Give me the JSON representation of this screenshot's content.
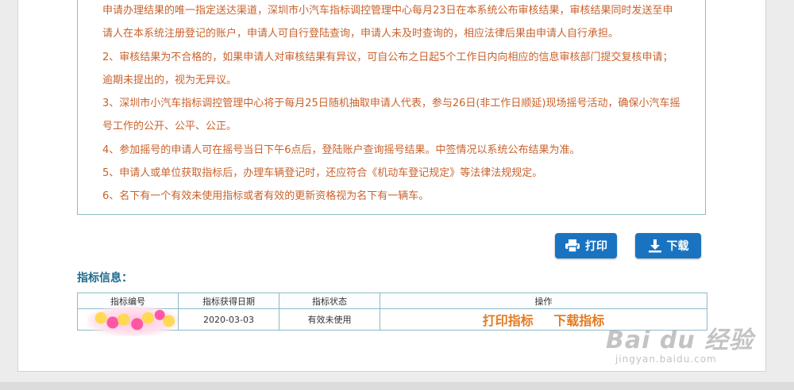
{
  "notice": {
    "lines": [
      "申请办理结果的唯一指定送达渠道，深圳市小汽车指标调控管理中心每月23日在本系统公布审核结果，审核结果同时发送至申",
      "请人在本系统注册登记的账户，申请人可自行登陆查询，申请人未及时查询的，相应法律后果由申请人自行承担。",
      "2、审核结果为不合格的，如果申请人对审核结果有异议，可自公布之日起5个工作日内向相应的信息审核部门提交复核申请；",
      "逾期未提出的，视为无异议。",
      "3、深圳市小汽车指标调控管理中心将于每月25日随机抽取申请人代表，参与26日(非工作日顺延)现场摇号活动，确保小汽车摇",
      "号工作的公开、公平、公正。",
      "4、参加摇号的申请人可在摇号当日下午6点后，登陆账户查询摇号结果。中签情况以系统公布结果为准。",
      "5、申请人或单位获取指标后，办理车辆登记时，还应符合《机动车登记规定》等法律法规规定。",
      "6、名下有一个有效未使用指标或者有效的更新资格视为名下有一辆车。"
    ]
  },
  "buttons": {
    "print": "打印",
    "download": "下载"
  },
  "section_title": "指标信息：",
  "table": {
    "headers": [
      "指标编号",
      "指标获得日期",
      "指标状态",
      "操作"
    ],
    "row": {
      "id": "",
      "date": "2020-03-03",
      "status": "有效未使用",
      "print_link": "打印指标",
      "download_link": "下载指标"
    }
  },
  "watermark": {
    "main": "Bai du 经验",
    "sub": "jingyan.baidu.com"
  },
  "colors": {
    "notice_text": "#c8622c",
    "button_bg": "#1a73c0",
    "link": "#e37b1f",
    "title": "#1e6a8d",
    "border": "#8fb9c9"
  }
}
